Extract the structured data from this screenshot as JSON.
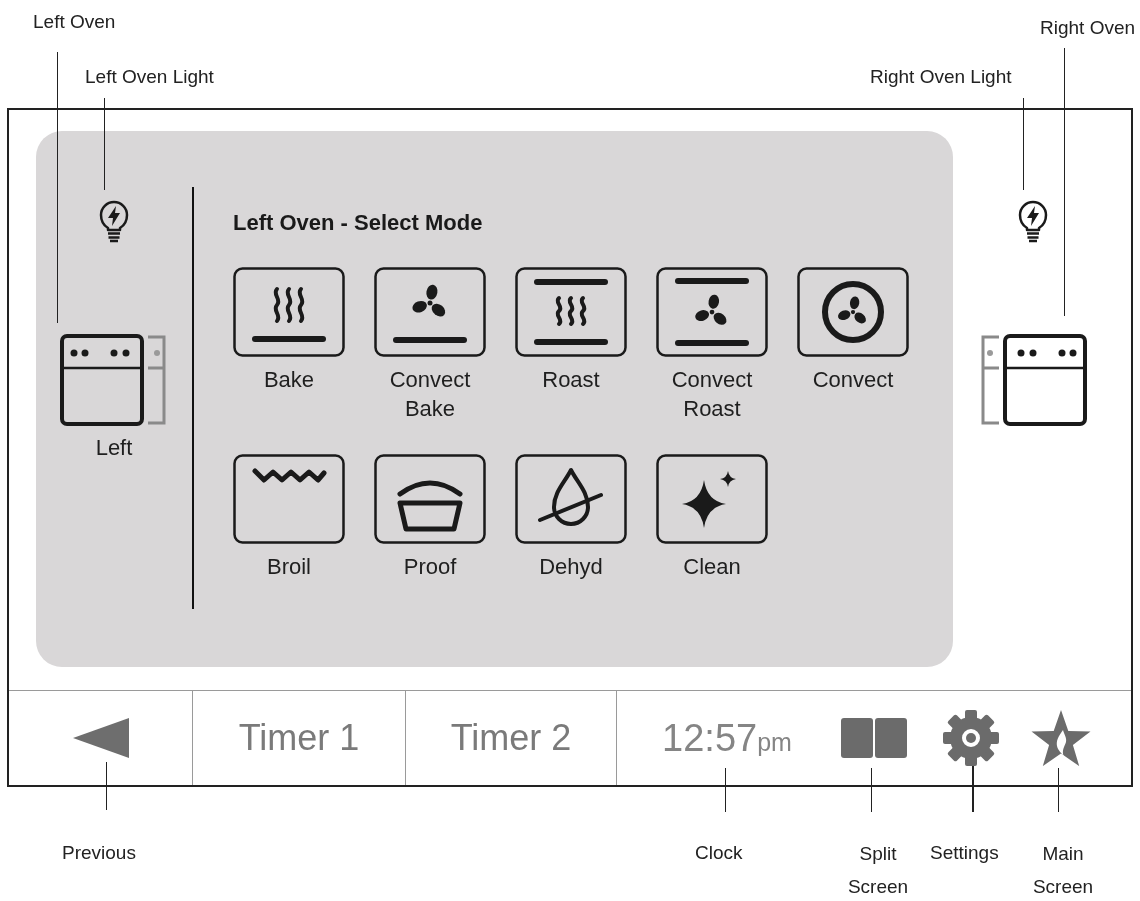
{
  "callouts": {
    "left_oven": "Left Oven",
    "left_oven_light": "Left Oven Light",
    "right_oven_light": "Right Oven Light",
    "right_oven": "Right Oven",
    "previous": "Previous",
    "clock": "Clock",
    "split_screen": "Split Screen",
    "settings": "Settings",
    "main_screen": "Main Screen"
  },
  "screen": {
    "left_oven": {
      "label": "Left",
      "selected": true
    },
    "right_oven": {
      "selected": false
    },
    "mode_title": "Left Oven - Select Mode",
    "modes": [
      {
        "kind": "bake",
        "label": "Bake"
      },
      {
        "kind": "convect_bake",
        "label": "Convect Bake"
      },
      {
        "kind": "roast",
        "label": "Roast"
      },
      {
        "kind": "convect_roast",
        "label": "Convect Roast"
      },
      {
        "kind": "convect",
        "label": "Convect"
      },
      {
        "kind": "broil",
        "label": "Broil"
      },
      {
        "kind": "proof",
        "label": "Proof"
      },
      {
        "kind": "dehyd",
        "label": "Dehyd"
      },
      {
        "kind": "clean",
        "label": "Clean"
      }
    ],
    "bottom_bar": {
      "timers": [
        "Timer 1",
        "Timer 2"
      ],
      "clock": {
        "time": "12:57",
        "period": "pm"
      }
    }
  }
}
